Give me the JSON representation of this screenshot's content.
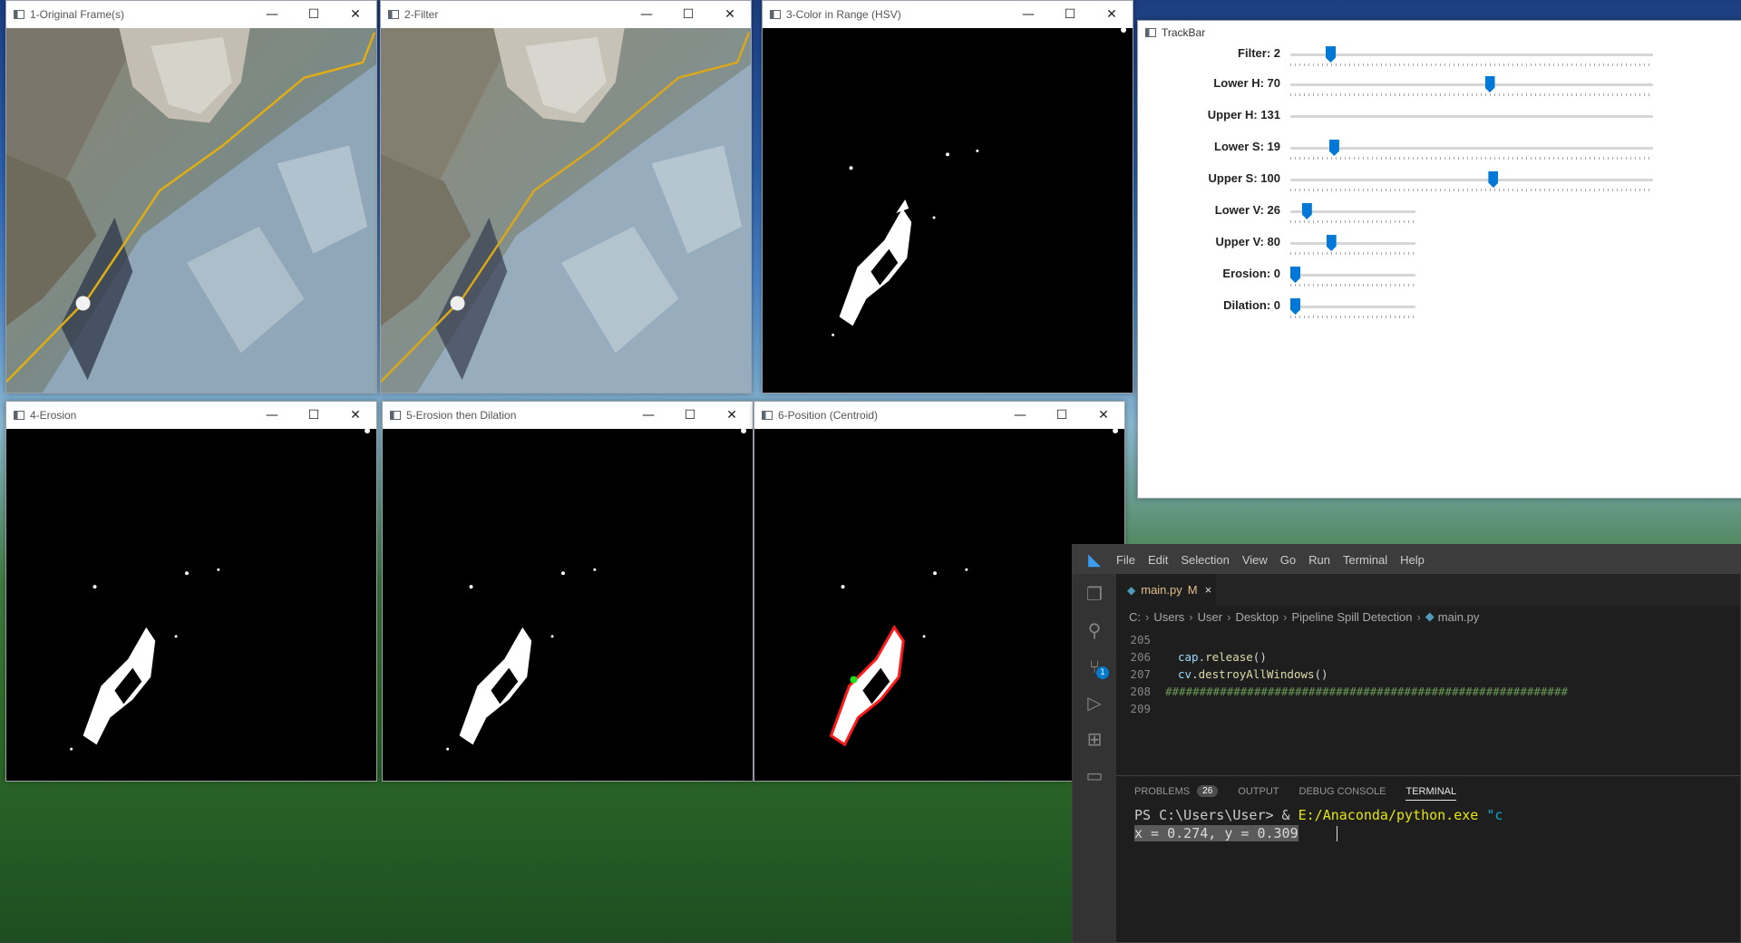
{
  "windows": {
    "original": {
      "title": "1-Original Frame(s)"
    },
    "filter": {
      "title": "2-Filter"
    },
    "color_range": {
      "title": "3-Color in Range (HSV)"
    },
    "erosion": {
      "title": "4-Erosion"
    },
    "erosion_dilation": {
      "title": "5-Erosion then Dilation"
    },
    "position": {
      "title": "6-Position (Centroid)"
    }
  },
  "window_controls": {
    "minimize": "—",
    "maximize": "☐",
    "close": "✕"
  },
  "trackbar": {
    "title": "TrackBar",
    "sliders": [
      {
        "label": "Filter: 2",
        "position": 0.1
      },
      {
        "label": "Lower H: 70",
        "position": 0.55
      },
      {
        "label": "Upper H: 131",
        "position": null
      },
      {
        "label": "Lower S: 19",
        "position": 0.11
      },
      {
        "label": "Upper S: 100",
        "position": 0.56
      },
      {
        "label": "Lower V: 26",
        "position": 0.1
      },
      {
        "label": "Upper V: 80",
        "position": 0.31
      },
      {
        "label": "Erosion: 0",
        "position": 0.0
      },
      {
        "label": "Dilation: 0",
        "position": 0.0
      }
    ]
  },
  "vscode": {
    "menu": [
      "File",
      "Edit",
      "Selection",
      "View",
      "Go",
      "Run",
      "Terminal",
      "Help"
    ],
    "tab": {
      "name": "main.py",
      "modified": "M",
      "close": "×"
    },
    "breadcrumb": [
      "C:",
      "Users",
      "User",
      "Desktop",
      "Pipeline Spill Detection",
      "main.py"
    ],
    "code": {
      "line_205": "205",
      "line_206": "206",
      "line_206_obj": "cap",
      "line_206_fn": "release",
      "line_207": "207",
      "line_207_obj": "cv",
      "line_207_fn": "destroyAllWindows",
      "line_208": "208",
      "line_208_text": "###########################################################",
      "line_209": "209",
      "parens": "()",
      "dot": "."
    },
    "panel_tabs": {
      "problems": "PROBLEMS",
      "problems_count": "26",
      "output": "OUTPUT",
      "debug": "DEBUG CONSOLE",
      "terminal": "TERMINAL"
    },
    "terminal": {
      "prompt": "PS C:\\Users\\User> & ",
      "exe": "E:/Anaconda/python.exe",
      "arg": "\"c",
      "output": "x = 0.274, y = 0.309"
    },
    "scm_badge": "1",
    "colors": {
      "accent": "#007acc",
      "background": "#1e1e1e"
    }
  }
}
